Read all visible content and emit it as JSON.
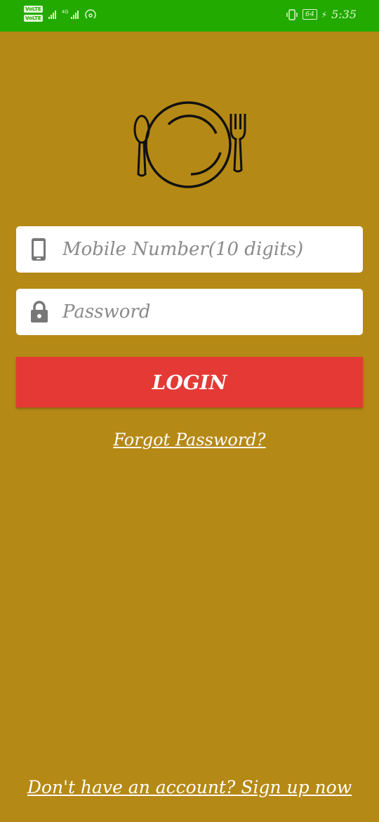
{
  "status_bar": {
    "volte_1": "VoLTE",
    "volte_2": "VoLTE",
    "network": "4G",
    "battery": "64",
    "time": "5:35"
  },
  "logo": {
    "icon": "plate-fork-spoon-icon"
  },
  "form": {
    "mobile_placeholder": "Mobile Number(10 digits)",
    "mobile_value": "",
    "mobile_icon": "phone-icon",
    "password_placeholder": "Password",
    "password_value": "",
    "password_icon": "lock-icon",
    "login_label": "LOGIN"
  },
  "links": {
    "forgot": "Forgot Password?",
    "signup": "Don't have an account? Sign up now"
  },
  "colors": {
    "background": "#b58915",
    "status_bar": "#22aa00",
    "login_button": "#e53935"
  }
}
